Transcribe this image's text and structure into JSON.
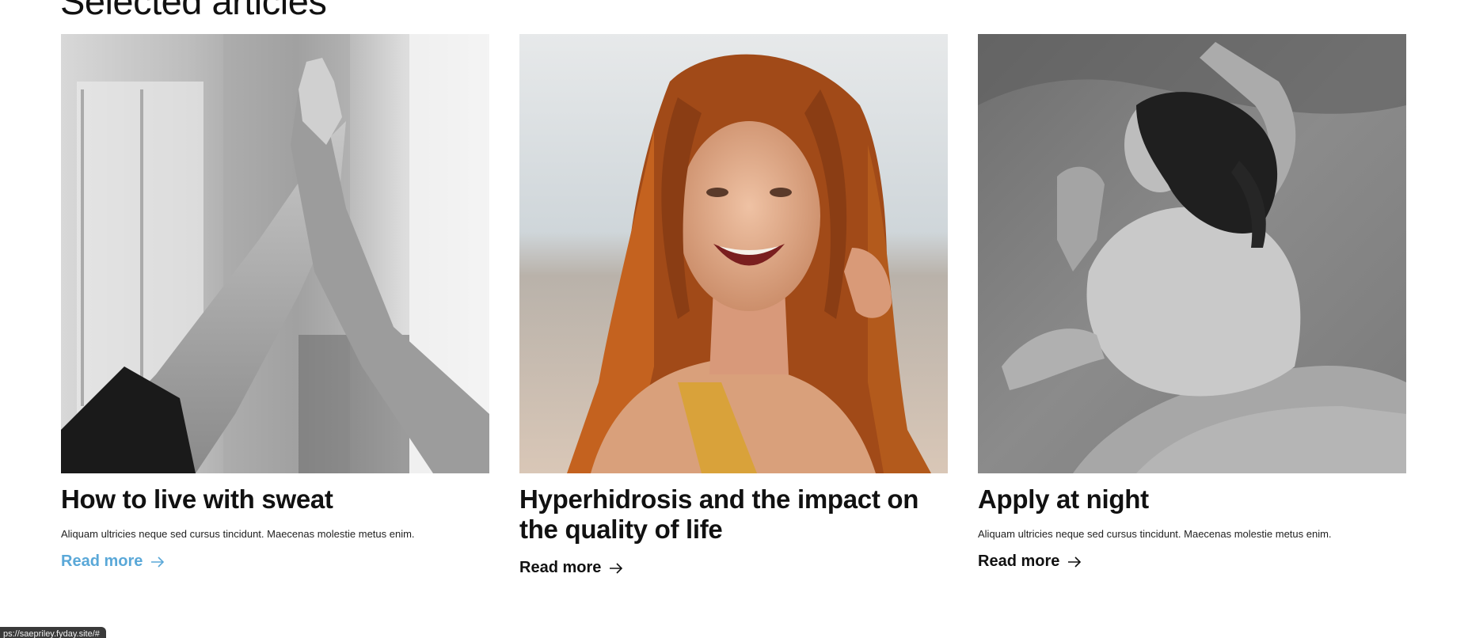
{
  "section": {
    "title": "Selected articles"
  },
  "articles": [
    {
      "title": "How to live with sweat",
      "excerpt": "Aliquam ultricies neque sed cursus tincidunt. Maecenas molestie metus enim.",
      "read_more": "Read more",
      "image": "high-five-hands-photo",
      "link_color": "#5aa8d8"
    },
    {
      "title": "Hyperhidrosis and the impact on the quality of life",
      "excerpt": "",
      "read_more": "Read more",
      "image": "smiling-red-haired-woman-photo"
    },
    {
      "title": "Apply at night",
      "excerpt": "Aliquam ultricies neque sed cursus tincidunt. Maecenas molestie metus enim.",
      "read_more": "Read more",
      "image": "woman-sleeping-in-bed-photo"
    }
  ],
  "status_bar": {
    "url": "ps://saepriley.fyday.site/#"
  }
}
